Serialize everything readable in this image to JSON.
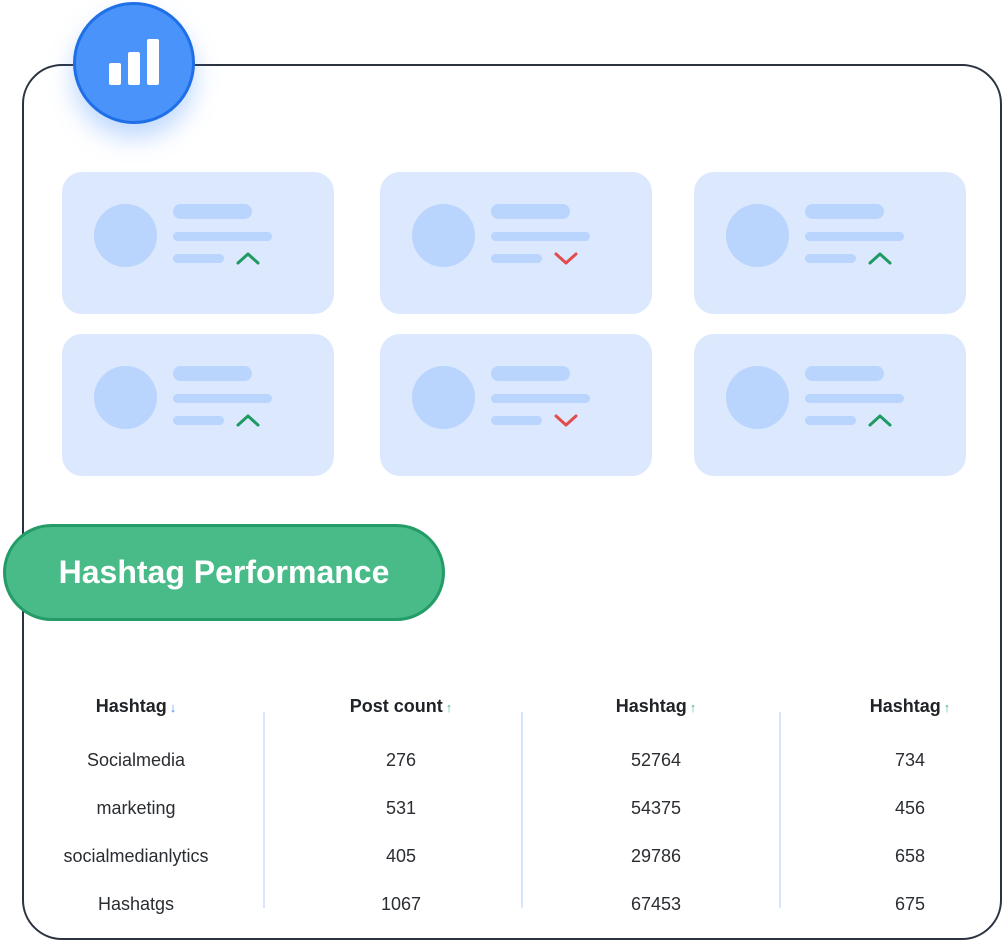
{
  "badge": {
    "icon": "bar-chart-icon",
    "color": "#4a93fb"
  },
  "cards": [
    {
      "trend": "up"
    },
    {
      "trend": "down"
    },
    {
      "trend": "up"
    },
    {
      "trend": "up"
    },
    {
      "trend": "down"
    },
    {
      "trend": "up"
    }
  ],
  "colors": {
    "up": "#1f9a63",
    "down": "#e34c4c",
    "accent_green": "#48bb89",
    "sort_blue": "#4a93fb"
  },
  "section_title": "Hashtag Performance",
  "table": {
    "columns": [
      {
        "label": "Hashtag",
        "sort": "down",
        "sort_icon": "↓"
      },
      {
        "label": "Post count",
        "sort": "up",
        "sort_icon": "↑"
      },
      {
        "label": "Hashtag",
        "sort": "up",
        "sort_icon": "↑"
      },
      {
        "label": "Hashtag",
        "sort": "up",
        "sort_icon": "↑"
      }
    ],
    "rows": [
      [
        "Socialmedia",
        "276",
        "52764",
        "734"
      ],
      [
        "marketing",
        "531",
        "54375",
        "456"
      ],
      [
        "socialmedianlytics",
        "405",
        "29786",
        "658"
      ],
      [
        "Hashatgs",
        "1067",
        "67453",
        "675"
      ]
    ]
  }
}
